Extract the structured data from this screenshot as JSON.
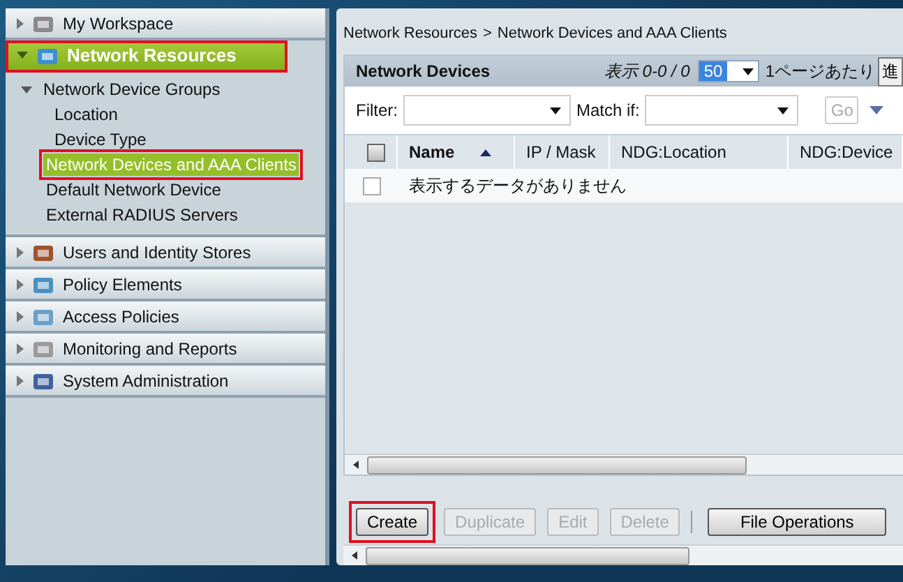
{
  "sidebar": {
    "sections": [
      {
        "label": "My Workspace",
        "expanded": false,
        "selected": false,
        "highlighted": false
      },
      {
        "label": "Network Resources",
        "expanded": true,
        "selected": true,
        "highlighted": true,
        "children": [
          {
            "label": "Network Device Groups",
            "expanded": true,
            "selected": false,
            "highlighted": false,
            "children": [
              {
                "label": "Location",
                "selected": false,
                "highlighted": false
              },
              {
                "label": "Device Type",
                "selected": false,
                "highlighted": false
              }
            ]
          },
          {
            "label": "Network Devices and AAA Clients",
            "selected": true,
            "highlighted": true
          },
          {
            "label": "Default Network Device",
            "selected": false,
            "highlighted": false
          },
          {
            "label": "External RADIUS Servers",
            "selected": false,
            "highlighted": false
          }
        ]
      },
      {
        "label": "Users and Identity Stores",
        "expanded": false,
        "selected": false,
        "highlighted": false
      },
      {
        "label": "Policy Elements",
        "expanded": false,
        "selected": false,
        "highlighted": false
      },
      {
        "label": "Access Policies",
        "expanded": false,
        "selected": false,
        "highlighted": false
      },
      {
        "label": "Monitoring and Reports",
        "expanded": false,
        "selected": false,
        "highlighted": false
      },
      {
        "label": "System Administration",
        "expanded": false,
        "selected": false,
        "highlighted": false
      }
    ]
  },
  "breadcrumb": {
    "items": [
      "Network Resources",
      "Network Devices and AAA Clients"
    ],
    "separator": ">"
  },
  "grid": {
    "title": "Network Devices",
    "paging": {
      "range": "表示 0-0 / 0",
      "page_size": "50",
      "per_page_label": "1ページあたり",
      "go_button": "進"
    },
    "filter": {
      "label": "Filter:",
      "match_label": "Match if:",
      "go_button": "Go",
      "go_disabled": true
    },
    "select_all_checked": false,
    "columns": [
      {
        "label": "Name",
        "sorted": true
      },
      {
        "label": "IP / Mask",
        "sorted": false
      },
      {
        "label": "NDG:Location",
        "sorted": false
      },
      {
        "label": "NDG:Device",
        "sorted": false
      }
    ],
    "empty_row": {
      "checked": false,
      "message": "表示するデータがありません"
    }
  },
  "buttons": [
    {
      "label": "Create",
      "disabled": false,
      "highlighted": true
    },
    {
      "label": "Duplicate",
      "disabled": true,
      "highlighted": false
    },
    {
      "label": "Edit",
      "disabled": true,
      "highlighted": false
    },
    {
      "label": "Delete",
      "disabled": true,
      "highlighted": false
    },
    {
      "kind": "separator"
    },
    {
      "label": "File Operations",
      "disabled": false,
      "highlighted": false
    }
  ]
}
